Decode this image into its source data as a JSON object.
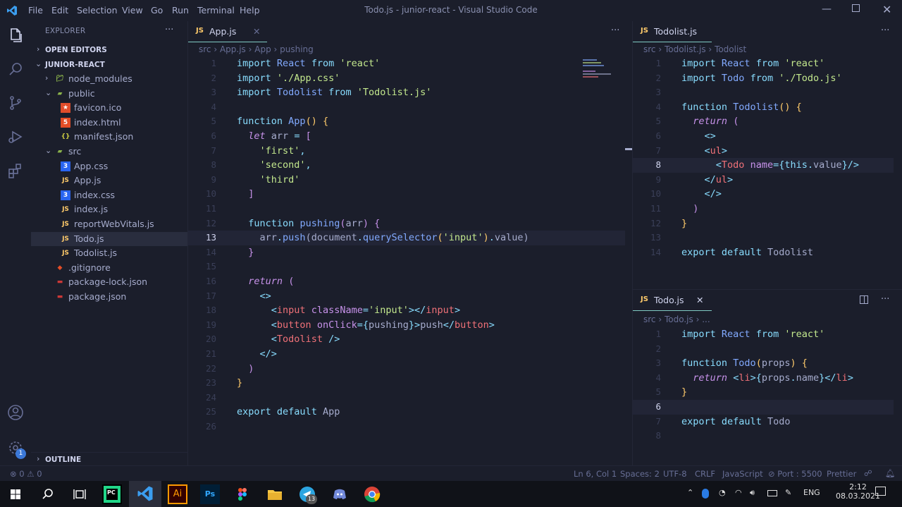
{
  "window": {
    "title": "Todo.js - junior-react - Visual Studio Code",
    "menu": [
      "File",
      "Edit",
      "Selection",
      "View",
      "Go",
      "Run",
      "Terminal",
      "Help"
    ]
  },
  "sidebar": {
    "title": "EXPLORER",
    "open_editors": "OPEN EDITORS",
    "project": "JUNIOR-REACT",
    "items": [
      {
        "label": "node_modules",
        "icon": "folder-icon",
        "depth": 1,
        "chev": "›"
      },
      {
        "label": "public",
        "icon": "folder-open-icon",
        "depth": 1,
        "chev": "⌄"
      },
      {
        "label": "favicon.ico",
        "icon": "star-icon",
        "depth": 2
      },
      {
        "label": "index.html",
        "icon": "html-icon",
        "depth": 2
      },
      {
        "label": "manifest.json",
        "icon": "json-icon",
        "depth": 2
      },
      {
        "label": "src",
        "icon": "folder-open-icon",
        "depth": 1,
        "chev": "⌄"
      },
      {
        "label": "App.css",
        "icon": "css-icon",
        "depth": 2
      },
      {
        "label": "App.js",
        "icon": "js-icon",
        "depth": 2
      },
      {
        "label": "index.css",
        "icon": "css-icon",
        "depth": 2
      },
      {
        "label": "index.js",
        "icon": "js-icon",
        "depth": 2
      },
      {
        "label": "reportWebVitals.js",
        "icon": "js-icon",
        "depth": 2
      },
      {
        "label": "Todo.js",
        "icon": "js-icon",
        "depth": 2,
        "selected": true
      },
      {
        "label": "Todolist.js",
        "icon": "js-icon",
        "depth": 2
      },
      {
        "label": ".gitignore",
        "icon": "git-icon",
        "depth": 1
      },
      {
        "label": "package-lock.json",
        "icon": "npm-icon",
        "depth": 1
      },
      {
        "label": "package.json",
        "icon": "npm-icon",
        "depth": 1
      }
    ],
    "outline": "OUTLINE"
  },
  "editor1": {
    "tab": "App.js",
    "crumbs": [
      "src",
      "App.js",
      "App",
      "pushing"
    ]
  },
  "editor2": {
    "tab": "Todolist.js",
    "crumbs": [
      "src",
      "Todolist.js",
      "Todolist"
    ]
  },
  "editor3": {
    "tab": "Todo.js",
    "crumbs": [
      "src",
      "Todo.js",
      "..."
    ]
  },
  "status": {
    "errors": "0",
    "warnings": "0",
    "position": "Ln 6, Col 1",
    "spaces": "Spaces: 2",
    "encoding": "UTF-8",
    "eol": "CRLF",
    "language": "JavaScript",
    "port": "Port : 5500",
    "formatter": "Prettier"
  },
  "taskbar": {
    "lang": "ENG",
    "time": "2:12",
    "date": "08.03.2021",
    "badge": "13"
  },
  "accounts_badge": "1"
}
